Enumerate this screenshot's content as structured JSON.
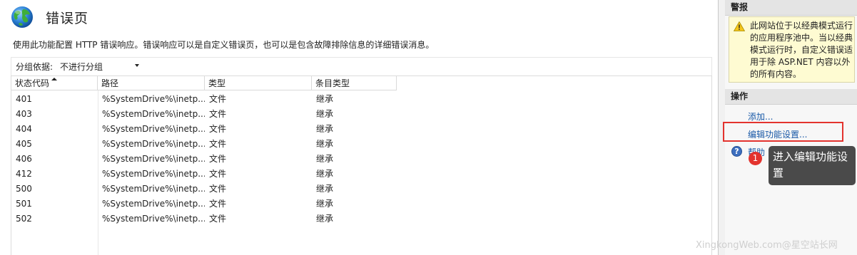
{
  "page": {
    "title": "错误页",
    "description": "使用此功能配置 HTTP 错误响应。错误响应可以是自定义错误页，也可以是包含故障排除信息的详细错误消息。"
  },
  "toolbar": {
    "group_by_label": "分组依据:",
    "group_by_value": "不进行分组"
  },
  "table": {
    "columns": [
      "状态代码",
      "路径",
      "类型",
      "条目类型"
    ],
    "sort_column": "状态代码",
    "sort_direction": "ascending",
    "rows": [
      {
        "code": "401",
        "path": "%SystemDrive%\\inetp...",
        "type": "文件",
        "entry": "继承"
      },
      {
        "code": "403",
        "path": "%SystemDrive%\\inetp...",
        "type": "文件",
        "entry": "继承"
      },
      {
        "code": "404",
        "path": "%SystemDrive%\\inetp...",
        "type": "文件",
        "entry": "继承"
      },
      {
        "code": "405",
        "path": "%SystemDrive%\\inetp...",
        "type": "文件",
        "entry": "继承"
      },
      {
        "code": "406",
        "path": "%SystemDrive%\\inetp...",
        "type": "文件",
        "entry": "继承"
      },
      {
        "code": "412",
        "path": "%SystemDrive%\\inetp...",
        "type": "文件",
        "entry": "继承"
      },
      {
        "code": "500",
        "path": "%SystemDrive%\\inetp...",
        "type": "文件",
        "entry": "继承"
      },
      {
        "code": "501",
        "path": "%SystemDrive%\\inetp...",
        "type": "文件",
        "entry": "继承"
      },
      {
        "code": "502",
        "path": "%SystemDrive%\\inetp...",
        "type": "文件",
        "entry": "继承"
      }
    ]
  },
  "alerts": {
    "title": "警报",
    "icon": "warning-icon",
    "message": "此网站位于以经典模式运行的应用程序池中。当以经典模式运行时，自定义错误适用于除 ASP.NET 内容以外的所有内容。"
  },
  "actions": {
    "title": "操作",
    "items": [
      {
        "label": "添加..."
      },
      {
        "label": "编辑功能设置..."
      },
      {
        "label": "帮助",
        "icon": "help-icon"
      }
    ]
  },
  "annotation": {
    "step_number": "1",
    "tooltip": "进入编辑功能设置",
    "highlight_color": "#e3332e"
  },
  "watermark": "XingkongWeb.com@星空站长网"
}
